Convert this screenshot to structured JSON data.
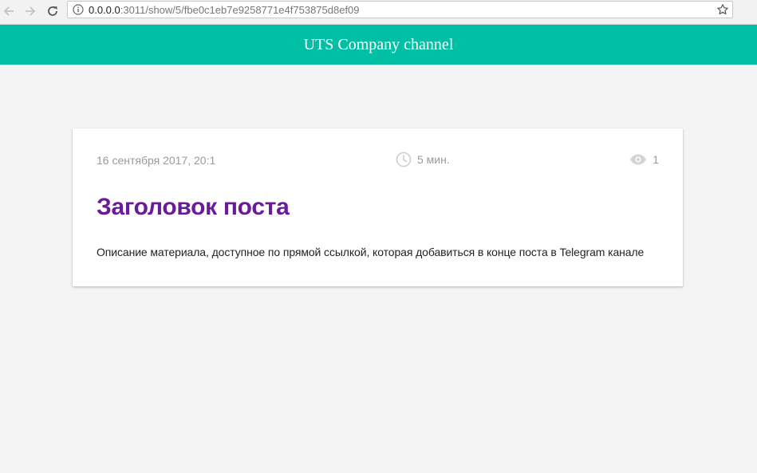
{
  "browser": {
    "url_host": "0.0.0.0",
    "url_rest": ":3011/show/5/fbe0c1eb7e9258771e4f753875d8ef09"
  },
  "header": {
    "title": "UTS Company channel",
    "background_color": "#00bfa5"
  },
  "post": {
    "date": "16 сентября 2017, 20:1",
    "read_time": "5 мин.",
    "views": "1",
    "title": "Заголовок поста",
    "title_color": "#6a1b9a",
    "description": "Описание материала, доступное по прямой ссылкой, которая добавиться в конце поста в Telegram канале"
  },
  "icons": {
    "back": "arrow-left-icon",
    "forward": "arrow-right-icon",
    "reload": "reload-icon",
    "info": "info-icon",
    "bookmark": "star-icon",
    "clock": "clock-icon",
    "views": "eye-icon"
  }
}
